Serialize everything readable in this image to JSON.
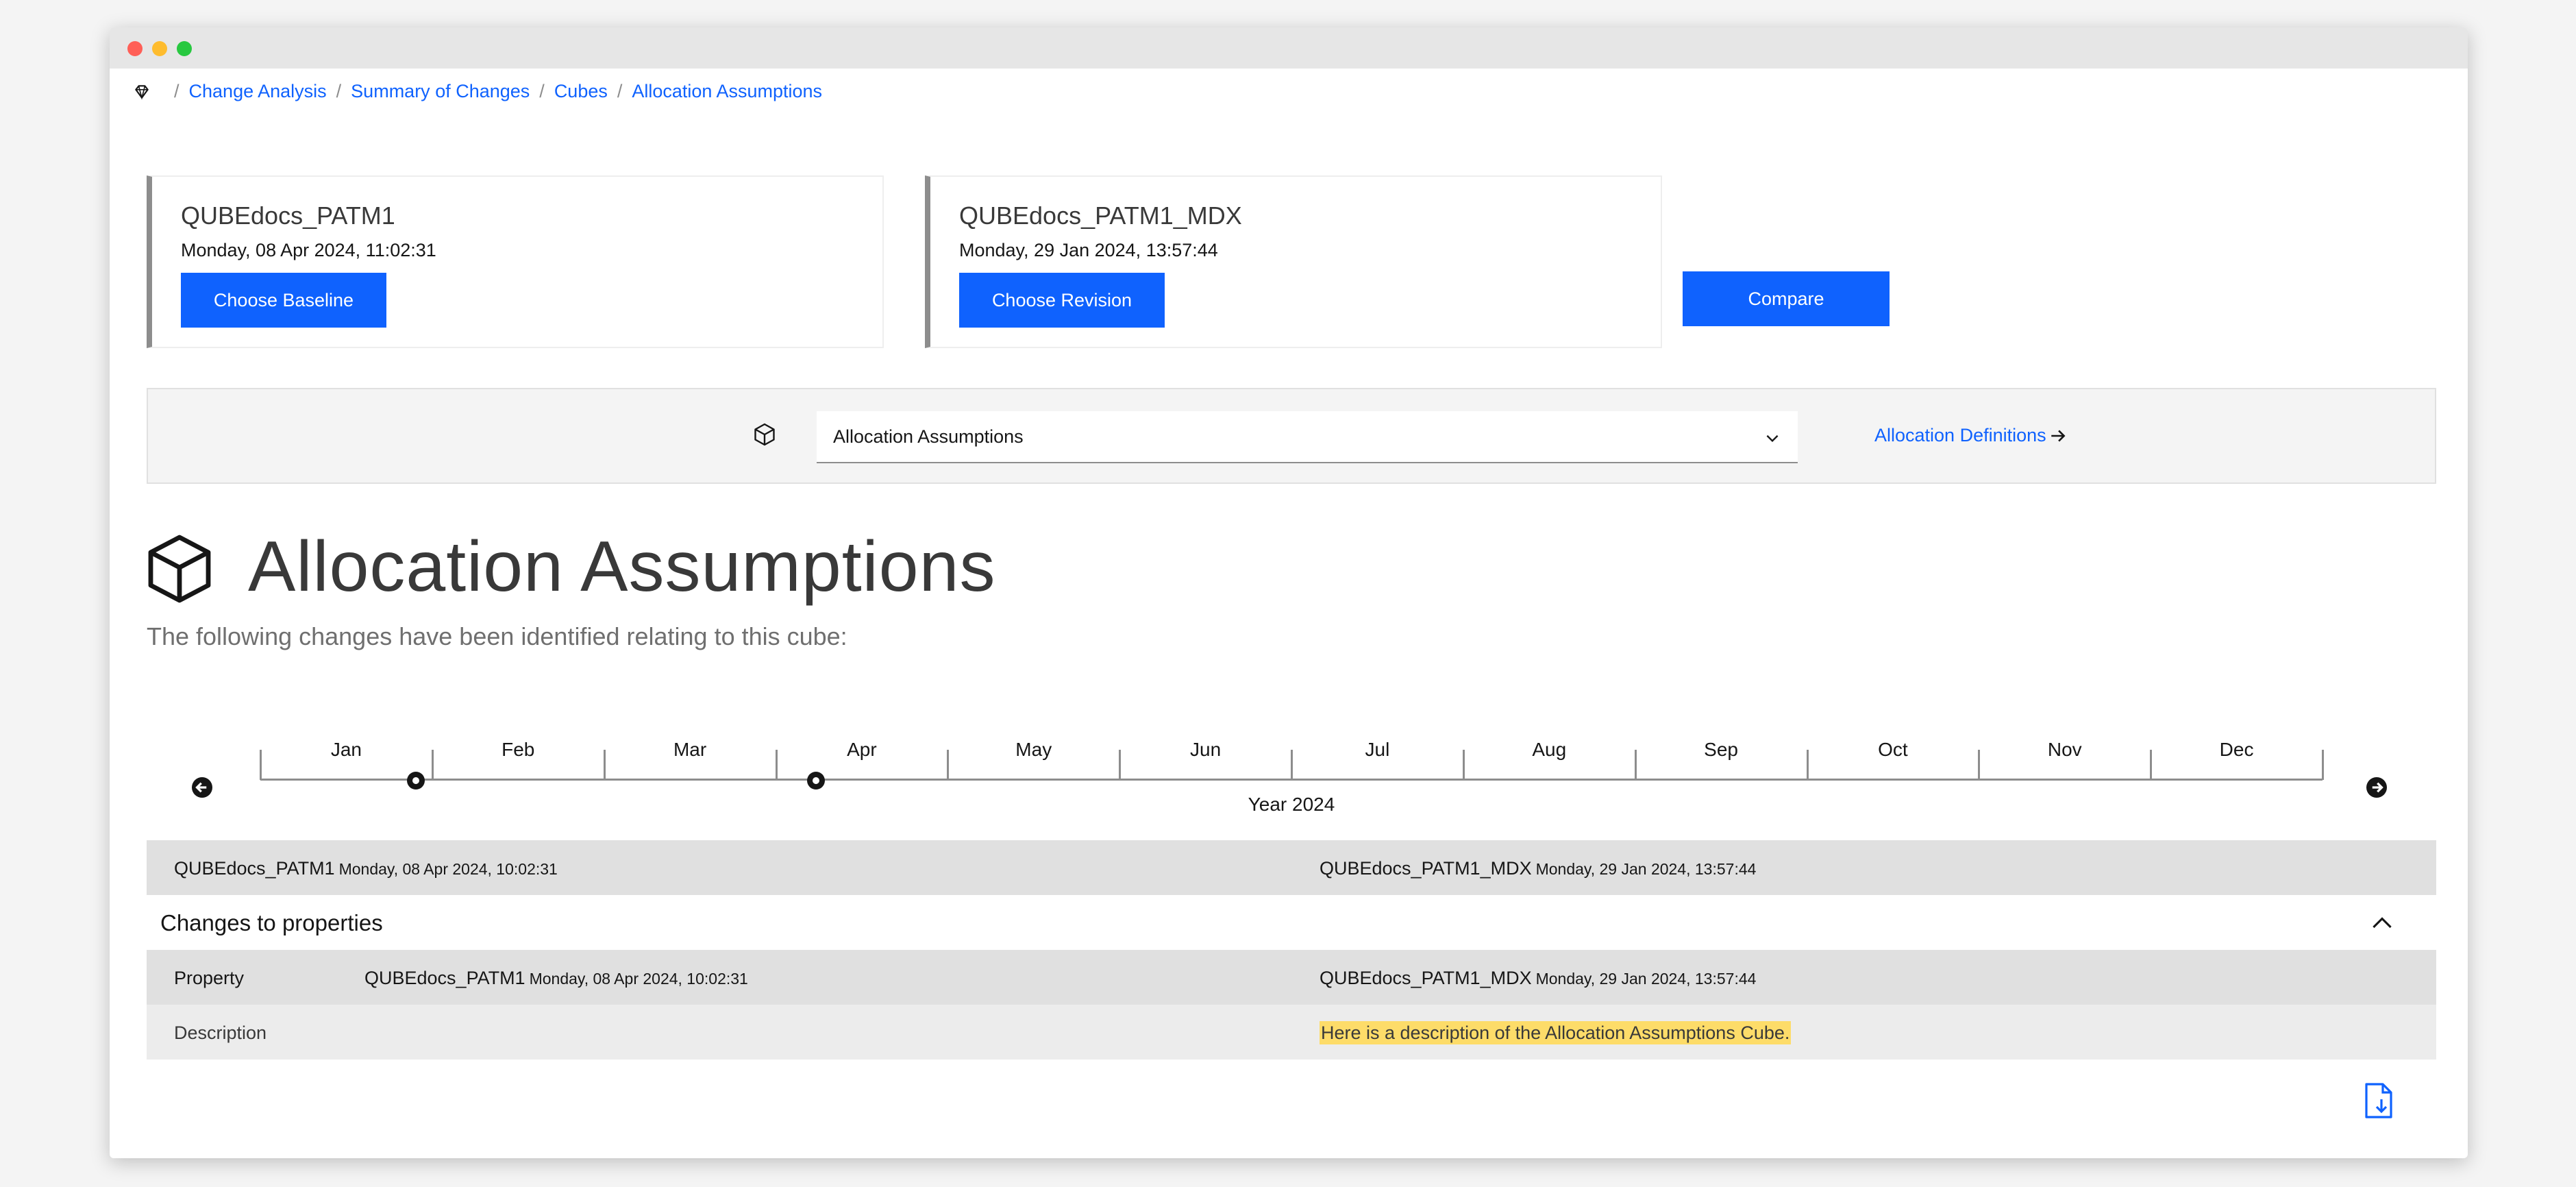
{
  "breadcrumb": {
    "items": [
      "Change Analysis",
      "Summary of Changes",
      "Cubes",
      "Allocation Assumptions"
    ]
  },
  "baseline": {
    "name": "QUBEdocs_PATM1",
    "date": "Monday, 08 Apr 2024, 11:02:31",
    "button": "Choose Baseline"
  },
  "revision": {
    "name": "QUBEdocs_PATM1_MDX",
    "date": "Monday, 29 Jan 2024, 13:57:44",
    "button": "Choose Revision"
  },
  "compare_button": "Compare",
  "cube_selector": {
    "selected": "Allocation Assumptions",
    "definitions_link": "Allocation Definitions"
  },
  "page": {
    "title": "Allocation Assumptions",
    "subtitle": "The following changes have been identified relating to this cube:"
  },
  "timeline": {
    "months": [
      "Jan",
      "Feb",
      "Mar",
      "Apr",
      "May",
      "Jun",
      "Jul",
      "Aug",
      "Sep",
      "Oct",
      "Nov",
      "Dec"
    ],
    "year_label": "Year 2024",
    "markers": [
      "2024-01-29",
      "2024-04-08"
    ]
  },
  "comparison": {
    "left_name": "QUBEdocs_PATM1",
    "left_date": "Monday, 08 Apr 2024, 10:02:31",
    "right_name": "QUBEdocs_PATM1_MDX",
    "right_date": "Monday, 29 Jan 2024, 13:57:44"
  },
  "properties_section": {
    "title": "Changes to properties",
    "header_property": "Property",
    "header_left_name": "QUBEdocs_PATM1",
    "header_left_date": "Monday, 08 Apr 2024, 10:02:31",
    "header_right_name": "QUBEdocs_PATM1_MDX",
    "header_right_date": "Monday, 29 Jan 2024, 13:57:44",
    "rows": [
      {
        "property": "Description",
        "left": "",
        "right": "Here is a description of the Allocation Assumptions Cube."
      }
    ]
  },
  "colors": {
    "primary": "#0f62fe",
    "highlight": "#fddc69",
    "header_bg": "#e0e0e0"
  },
  "icons": {
    "home": "home-icon",
    "cube": "cube-icon",
    "chevron": "chevron-down-icon",
    "arrow": "arrow-right-icon",
    "export": "export-document-icon"
  }
}
